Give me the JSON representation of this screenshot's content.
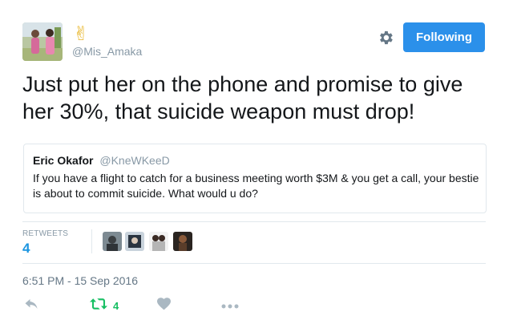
{
  "author": {
    "name": "✌",
    "handle": "@Mis_Amaka",
    "avatar": "avatar-photo"
  },
  "header": {
    "settings_icon": "gear-icon",
    "follow_label": "Following"
  },
  "tweet": {
    "text": "Just put her on the phone and promise to give her 30%, that suicide weapon must drop!"
  },
  "quoted_tweet": {
    "name": "Eric Okafor",
    "handle": "@KneWKeeD",
    "text": "If you have a flight to catch for a business meeting worth $3M &  you get a call, your bestie is about to commit suicide.  What would u do?"
  },
  "stats": {
    "retweets_label": "RETWEETS",
    "retweets_count": "4"
  },
  "timestamp": "6:51 PM - 15 Sep 2016",
  "actions": {
    "reply_icon": "reply-icon",
    "retweet_icon": "retweet-icon",
    "retweet_count": "4",
    "like_icon": "heart-icon",
    "more_icon": "more-icon"
  },
  "colors": {
    "accent": "#1b95e0",
    "follow_button": "#2b90ea",
    "retweet_green": "#17bf63",
    "muted": "#8899a6",
    "border": "#e1e8ed"
  }
}
